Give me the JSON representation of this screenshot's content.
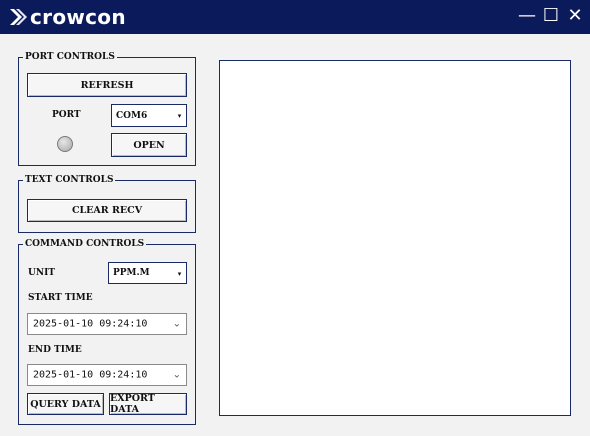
{
  "window": {
    "brand": "crowcon",
    "controls": {
      "minimize": "—",
      "maximize": "☐",
      "close": "✕"
    }
  },
  "port_controls": {
    "legend": "PORT CONTROLS",
    "refresh_label": "REFRESH",
    "port_label": "PORT",
    "port_value": "COM6",
    "open_label": "OPEN"
  },
  "text_controls": {
    "legend": "TEXT CONTROLS",
    "clear_label": "CLEAR RECV"
  },
  "command_controls": {
    "legend": "COMMAND CONTROLS",
    "unit_label": "UNIT",
    "unit_value": "PPM.M",
    "start_label": "START TIME",
    "start_value": "2025-01-10 09:24:10",
    "end_label": "END TIME",
    "end_value": "2025-01-10 09:24:10",
    "query_label": "QUERY DATA",
    "export_label": "EXPORT DATA"
  },
  "icons": {
    "dropdown_arrow": "▾",
    "date_chevron": "⌄"
  },
  "colors": {
    "titlebar": "#0b1a5a",
    "accent_border": "#1a2a66",
    "window_bg": "#f2f2f2"
  }
}
